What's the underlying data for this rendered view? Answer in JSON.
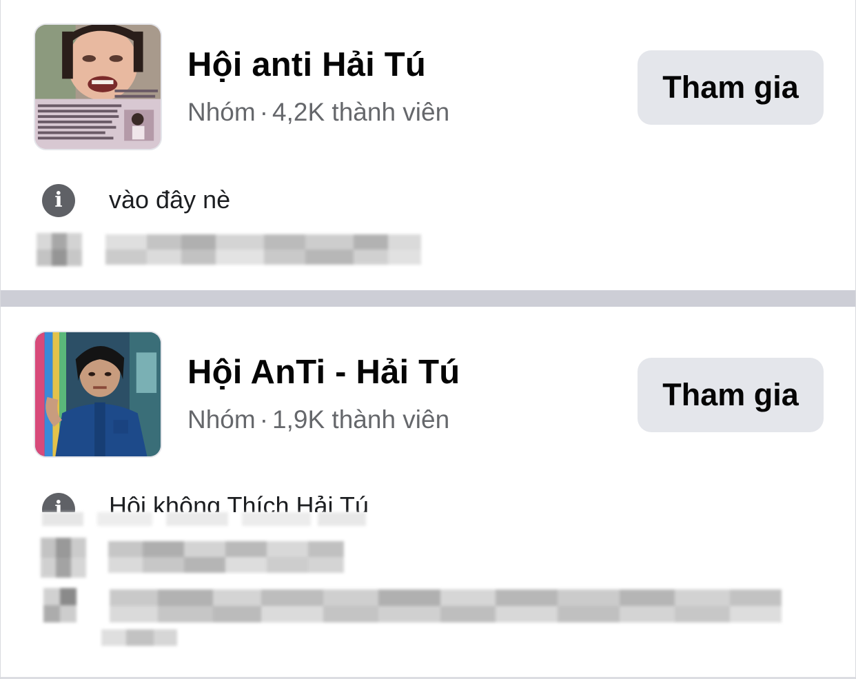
{
  "colors": {
    "button_bg": "#e4e6eb",
    "title_text": "#050505",
    "meta_text": "#65676b",
    "divider": "#cdced6",
    "info_icon_bg": "#5f6166"
  },
  "groups": [
    {
      "name": "Hội anti Hải Tú",
      "type": "Nhóm",
      "members": "4,2K thành viên",
      "join_label": "Tham gia",
      "description": "vào đây nè",
      "info_icon": "info-icon"
    },
    {
      "name": "Hội AnTi - Hải Tú",
      "type": "Nhóm",
      "members": "1,9K thành viên",
      "join_label": "Tham gia",
      "description": "Hội không Thích Hải Tú",
      "info_icon": "info-icon"
    }
  ]
}
